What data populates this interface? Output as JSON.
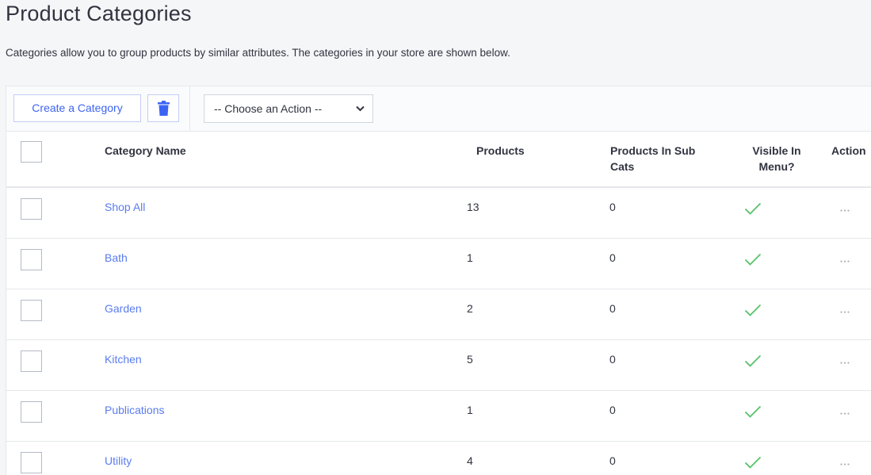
{
  "page": {
    "title": "Product Categories",
    "description": "Categories allow you to group products by similar attributes. The categories in your store are shown below."
  },
  "toolbar": {
    "create_label": "Create a Category",
    "action_select_value": "-- Choose an Action --"
  },
  "table": {
    "headers": {
      "name": "Category Name",
      "products": "Products",
      "subcats": "Products In Sub Cats",
      "visible": "Visible In Menu?",
      "action": "Action"
    },
    "rows": [
      {
        "name": "Shop All",
        "products": "13",
        "subcats": "0",
        "visible": true
      },
      {
        "name": "Bath",
        "products": "1",
        "subcats": "0",
        "visible": true
      },
      {
        "name": "Garden",
        "products": "2",
        "subcats": "0",
        "visible": true
      },
      {
        "name": "Kitchen",
        "products": "5",
        "subcats": "0",
        "visible": true
      },
      {
        "name": "Publications",
        "products": "1",
        "subcats": "0",
        "visible": true
      },
      {
        "name": "Utility",
        "products": "4",
        "subcats": "0",
        "visible": true
      }
    ]
  },
  "colors": {
    "link": "#5a7cf0",
    "check": "#56c26a",
    "accent": "#3c64f4"
  },
  "icons": {
    "delete": "trash-icon",
    "select": "chevron-down-icon",
    "visible": "checkmark-icon",
    "row_action": "more-dots-icon"
  }
}
